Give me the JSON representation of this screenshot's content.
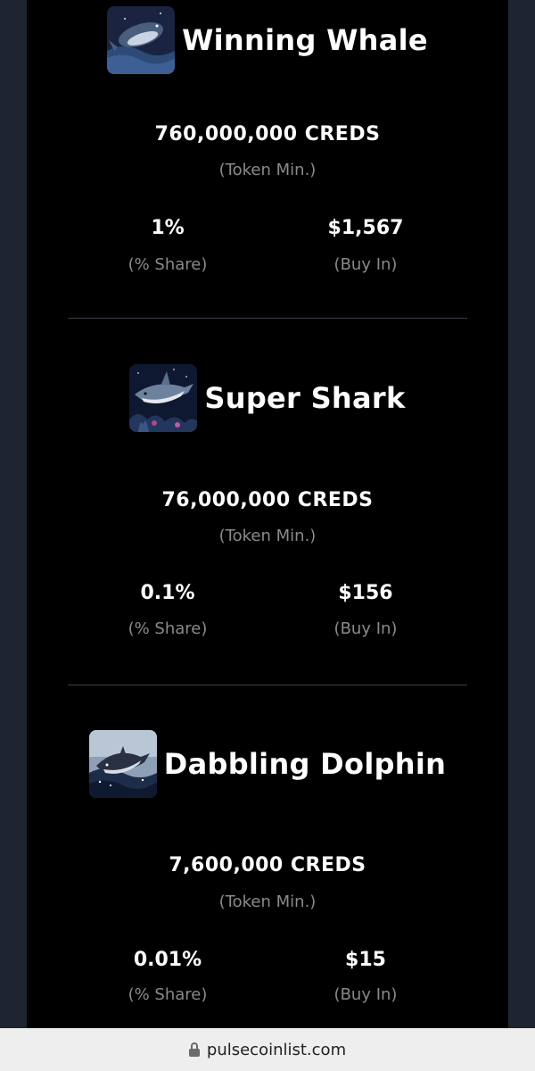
{
  "tiers": [
    {
      "name": "Winning Whale",
      "icon": "whale-icon",
      "token_amount": "760,000,000 CREDS",
      "token_label": "(Token Min.)",
      "share_value": "1%",
      "share_label": "(% Share)",
      "buyin_value": "$1,567",
      "buyin_label": "(Buy In)"
    },
    {
      "name": "Super Shark",
      "icon": "shark-icon",
      "token_amount": "76,000,000 CREDS",
      "token_label": "(Token Min.)",
      "share_value": "0.1%",
      "share_label": "(% Share)",
      "buyin_value": "$156",
      "buyin_label": "(Buy In)"
    },
    {
      "name": "Dabbling Dolphin",
      "icon": "dolphin-icon",
      "token_amount": "7,600,000 CREDS",
      "token_label": "(Token Min.)",
      "share_value": "0.01%",
      "share_label": "(% Share)",
      "buyin_value": "$15",
      "buyin_label": "(Buy In)"
    }
  ],
  "url_bar": {
    "domain": "pulsecoinlist.com",
    "icon": "lock-icon"
  },
  "colors": {
    "background": "#000000",
    "side_panel": "#1f2530",
    "label_gray": "#8a8a8a",
    "divider": "#3a3f48",
    "url_bar": "#eeeeee"
  }
}
